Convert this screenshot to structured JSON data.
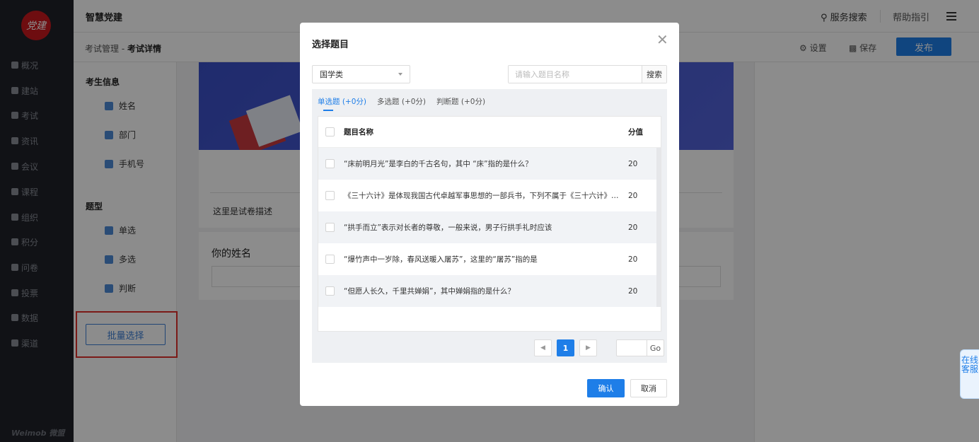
{
  "nav": {
    "logo_text": "党建",
    "items": [
      {
        "label": "概况",
        "icon": "overview-icon"
      },
      {
        "label": "建站",
        "icon": "site-icon"
      },
      {
        "label": "考试",
        "icon": "exam-icon"
      },
      {
        "label": "资讯",
        "icon": "news-icon"
      },
      {
        "label": "会议",
        "icon": "meeting-icon"
      },
      {
        "label": "课程",
        "icon": "course-icon"
      },
      {
        "label": "组织",
        "icon": "org-icon"
      },
      {
        "label": "积分",
        "icon": "points-icon"
      },
      {
        "label": "问卷",
        "icon": "survey-icon"
      },
      {
        "label": "投票",
        "icon": "vote-icon"
      },
      {
        "label": "数据",
        "icon": "data-icon"
      },
      {
        "label": "渠道",
        "icon": "channel-icon"
      }
    ],
    "brand": "Weimob 微盟"
  },
  "header": {
    "app_name": "智慧党建",
    "service_search": "服务搜索",
    "help": "帮助指引"
  },
  "subbar": {
    "crumb_parent": "考试管理 - ",
    "crumb_current": "考试详情",
    "settings": "设置",
    "save": "保存",
    "publish": "发布"
  },
  "left_panel": {
    "candidate_header": "考生信息",
    "fields": [
      "姓名",
      "部门",
      "手机号"
    ],
    "qtype_header": "题型",
    "qtypes": [
      "单选",
      "多选",
      "判断"
    ],
    "batch_button": "批量选择"
  },
  "canvas": {
    "description": "这里是试卷描述",
    "question_title": "你的姓名"
  },
  "kefu": "在线客服",
  "modal": {
    "title": "选择题目",
    "category": "国学类",
    "search_placeholder": "请输入题目名称",
    "search_button": "搜索",
    "tabs": [
      "单选题 (+0分)",
      "多选题 (+0分)",
      "判断题 (+0分)"
    ],
    "active_tab": 0,
    "columns": {
      "name": "题目名称",
      "score": "分值"
    },
    "rows": [
      {
        "name": "“床前明月光”是李白的千古名句，其中 “床”指的是什么？",
        "score": "20"
      },
      {
        "name": "《三十六计》是体现我国古代卓越军事思想的一部兵书，下列不属于《三十六计》的是",
        "score": "20"
      },
      {
        "name": "“拱手而立”表示对长者的尊敬，一般来说，男子行拱手礼时应该",
        "score": "20"
      },
      {
        "name": "“爆竹声中一岁除，春风送暖入屠苏”，这里的“屠苏”指的是",
        "score": "20"
      },
      {
        "name": "“但愿人长久，千里共婵娟”，其中婵娟指的是什么？",
        "score": "20"
      }
    ],
    "pager": {
      "current": "1",
      "go": "Go"
    },
    "confirm": "确认",
    "cancel": "取消"
  }
}
